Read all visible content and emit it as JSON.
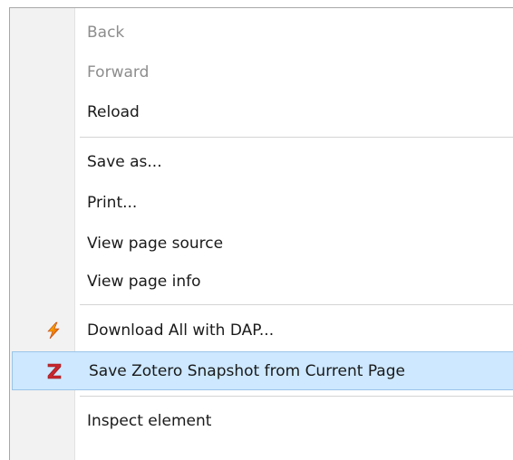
{
  "menu": {
    "items": [
      {
        "label": "Back",
        "state": "disabled"
      },
      {
        "label": "Forward",
        "state": "disabled"
      },
      {
        "label": "Reload",
        "state": "enabled"
      },
      {
        "label": "Save as...",
        "state": "enabled"
      },
      {
        "label": "Print...",
        "state": "enabled"
      },
      {
        "label": "View page source",
        "state": "enabled"
      },
      {
        "label": "View page info",
        "state": "enabled"
      },
      {
        "label": "Download All with DAP...",
        "state": "enabled",
        "icon": "lightning-icon"
      },
      {
        "label": "Save Zotero Snapshot from Current Page",
        "state": "highlighted",
        "icon": "zotero-z-icon"
      },
      {
        "label": "Inspect element",
        "state": "enabled"
      }
    ]
  },
  "colors": {
    "highlight_background": "#cde8ff",
    "highlight_border": "#9bc4e8",
    "disabled_text": "#8d8d8d",
    "zotero_red": "#c8262d",
    "lightning_orange": "#f29100",
    "lightning_red": "#e0251b"
  }
}
